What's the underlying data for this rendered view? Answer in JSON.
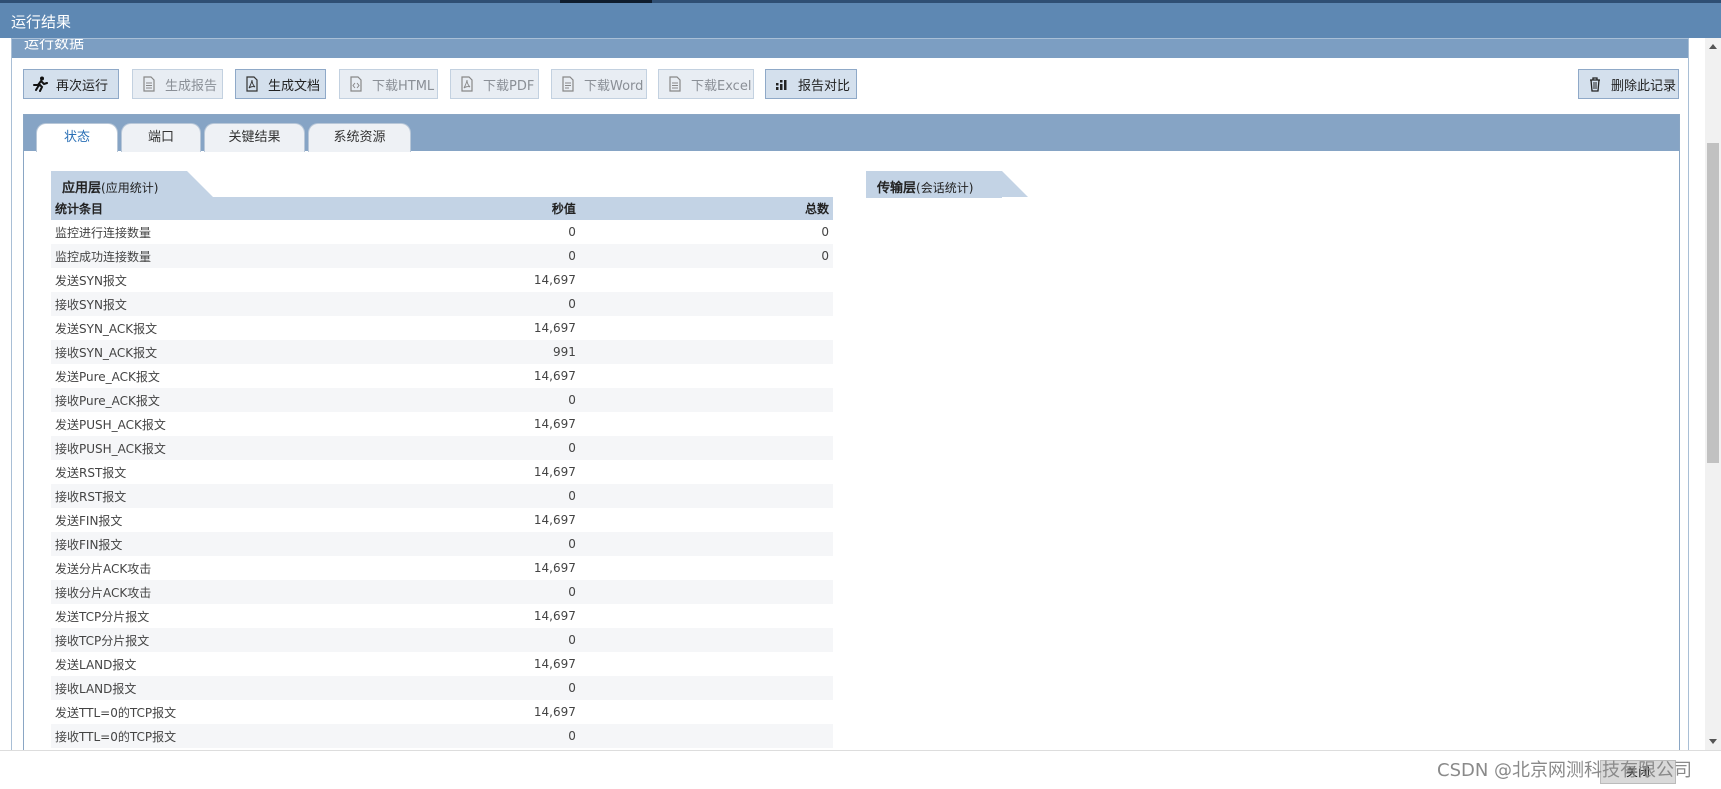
{
  "window": {
    "title": "运行结果"
  },
  "panel": {
    "title": "运行数据"
  },
  "toolbar": {
    "buttons": [
      {
        "label": "再次运行",
        "icon": "running-man-icon"
      },
      {
        "label": "生成报告",
        "icon": "document-icon"
      },
      {
        "label": "生成文档",
        "icon": "pdf-document-icon"
      },
      {
        "label": "下载HTML",
        "icon": "html-document-icon"
      },
      {
        "label": "下载PDF",
        "icon": "pdf-document-icon"
      },
      {
        "label": "下载Word",
        "icon": "word-document-icon"
      },
      {
        "label": "下载Excel",
        "icon": "excel-document-icon"
      },
      {
        "label": "报告对比",
        "icon": "bar-chart-icon"
      }
    ],
    "delete_label": "删除此记录"
  },
  "tabs": [
    "状态",
    "端口",
    "关键结果",
    "系统资源"
  ],
  "app_layer": {
    "title": "应用层",
    "subtitle": "(应用统计)",
    "headers": [
      "统计条目",
      "秒值",
      "总数"
    ],
    "rows": [
      [
        "监控进行连接数量",
        "0",
        "0"
      ],
      [
        "监控成功连接数量",
        "0",
        "0"
      ],
      [
        "发送SYN报文",
        "14,697",
        ""
      ],
      [
        "接收SYN报文",
        "0",
        ""
      ],
      [
        "发送SYN_ACK报文",
        "14,697",
        ""
      ],
      [
        "接收SYN_ACK报文",
        "991",
        ""
      ],
      [
        "发送Pure_ACK报文",
        "14,697",
        ""
      ],
      [
        "接收Pure_ACK报文",
        "0",
        ""
      ],
      [
        "发送PUSH_ACK报文",
        "14,697",
        ""
      ],
      [
        "接收PUSH_ACK报文",
        "0",
        ""
      ],
      [
        "发送RST报文",
        "14,697",
        ""
      ],
      [
        "接收RST报文",
        "0",
        ""
      ],
      [
        "发送FIN报文",
        "14,697",
        ""
      ],
      [
        "接收FIN报文",
        "0",
        ""
      ],
      [
        "发送分片ACK攻击",
        "14,697",
        ""
      ],
      [
        "接收分片ACK攻击",
        "0",
        ""
      ],
      [
        "发送TCP分片报文",
        "14,697",
        ""
      ],
      [
        "接收TCP分片报文",
        "0",
        ""
      ],
      [
        "发送LAND报文",
        "14,697",
        ""
      ],
      [
        "接收LAND报文",
        "0",
        ""
      ],
      [
        "发送TTL=0的TCP报文",
        "14,697",
        ""
      ],
      [
        "接收TTL=0的TCP报文",
        "0",
        ""
      ]
    ]
  },
  "transport_layer": {
    "title": "传输层",
    "subtitle": "(会话统计)"
  },
  "footer": {
    "close_label": "关闭",
    "watermark": "CSDN @北京网测科技有限公司"
  }
}
